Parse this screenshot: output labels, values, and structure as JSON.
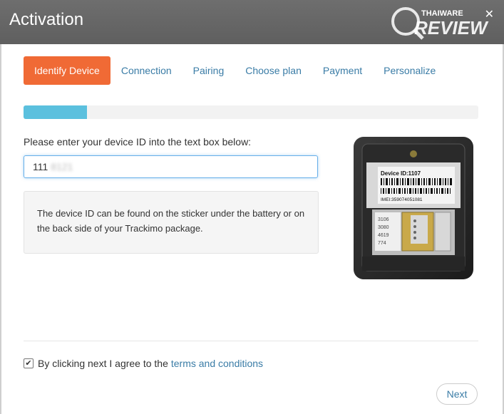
{
  "window": {
    "title": "Activation",
    "watermark": {
      "brand": "THAIWARE",
      "word": "REVIEW"
    }
  },
  "tabs": [
    {
      "label": "Identify Device",
      "active": true
    },
    {
      "label": "Connection",
      "active": false
    },
    {
      "label": "Pairing",
      "active": false
    },
    {
      "label": "Choose plan",
      "active": false
    },
    {
      "label": "Payment",
      "active": false
    },
    {
      "label": "Personalize",
      "active": false
    }
  ],
  "progress": {
    "fraction": 0.14
  },
  "form": {
    "prompt": "Please enter your device ID into the text box below:",
    "device_id_visible": "111",
    "device_id_blurred": "8121",
    "help_text": "The device ID can be found on the sticker under the battery or on the back side of your Trackimo package."
  },
  "photo": {
    "label_device_id": "Device ID:1107",
    "label_imei": "IMEI:359074051081",
    "sim_digits": [
      "3106",
      "3080",
      "4619",
      "774"
    ]
  },
  "footer": {
    "agree_checked": true,
    "agree_text": "By clicking next I agree to the",
    "terms_link": "terms and conditions",
    "next_label": "Next"
  },
  "colors": {
    "header": "#636363",
    "active_tab": "#f06a35",
    "link": "#3a7ca6",
    "progress": "#5bc0de"
  }
}
